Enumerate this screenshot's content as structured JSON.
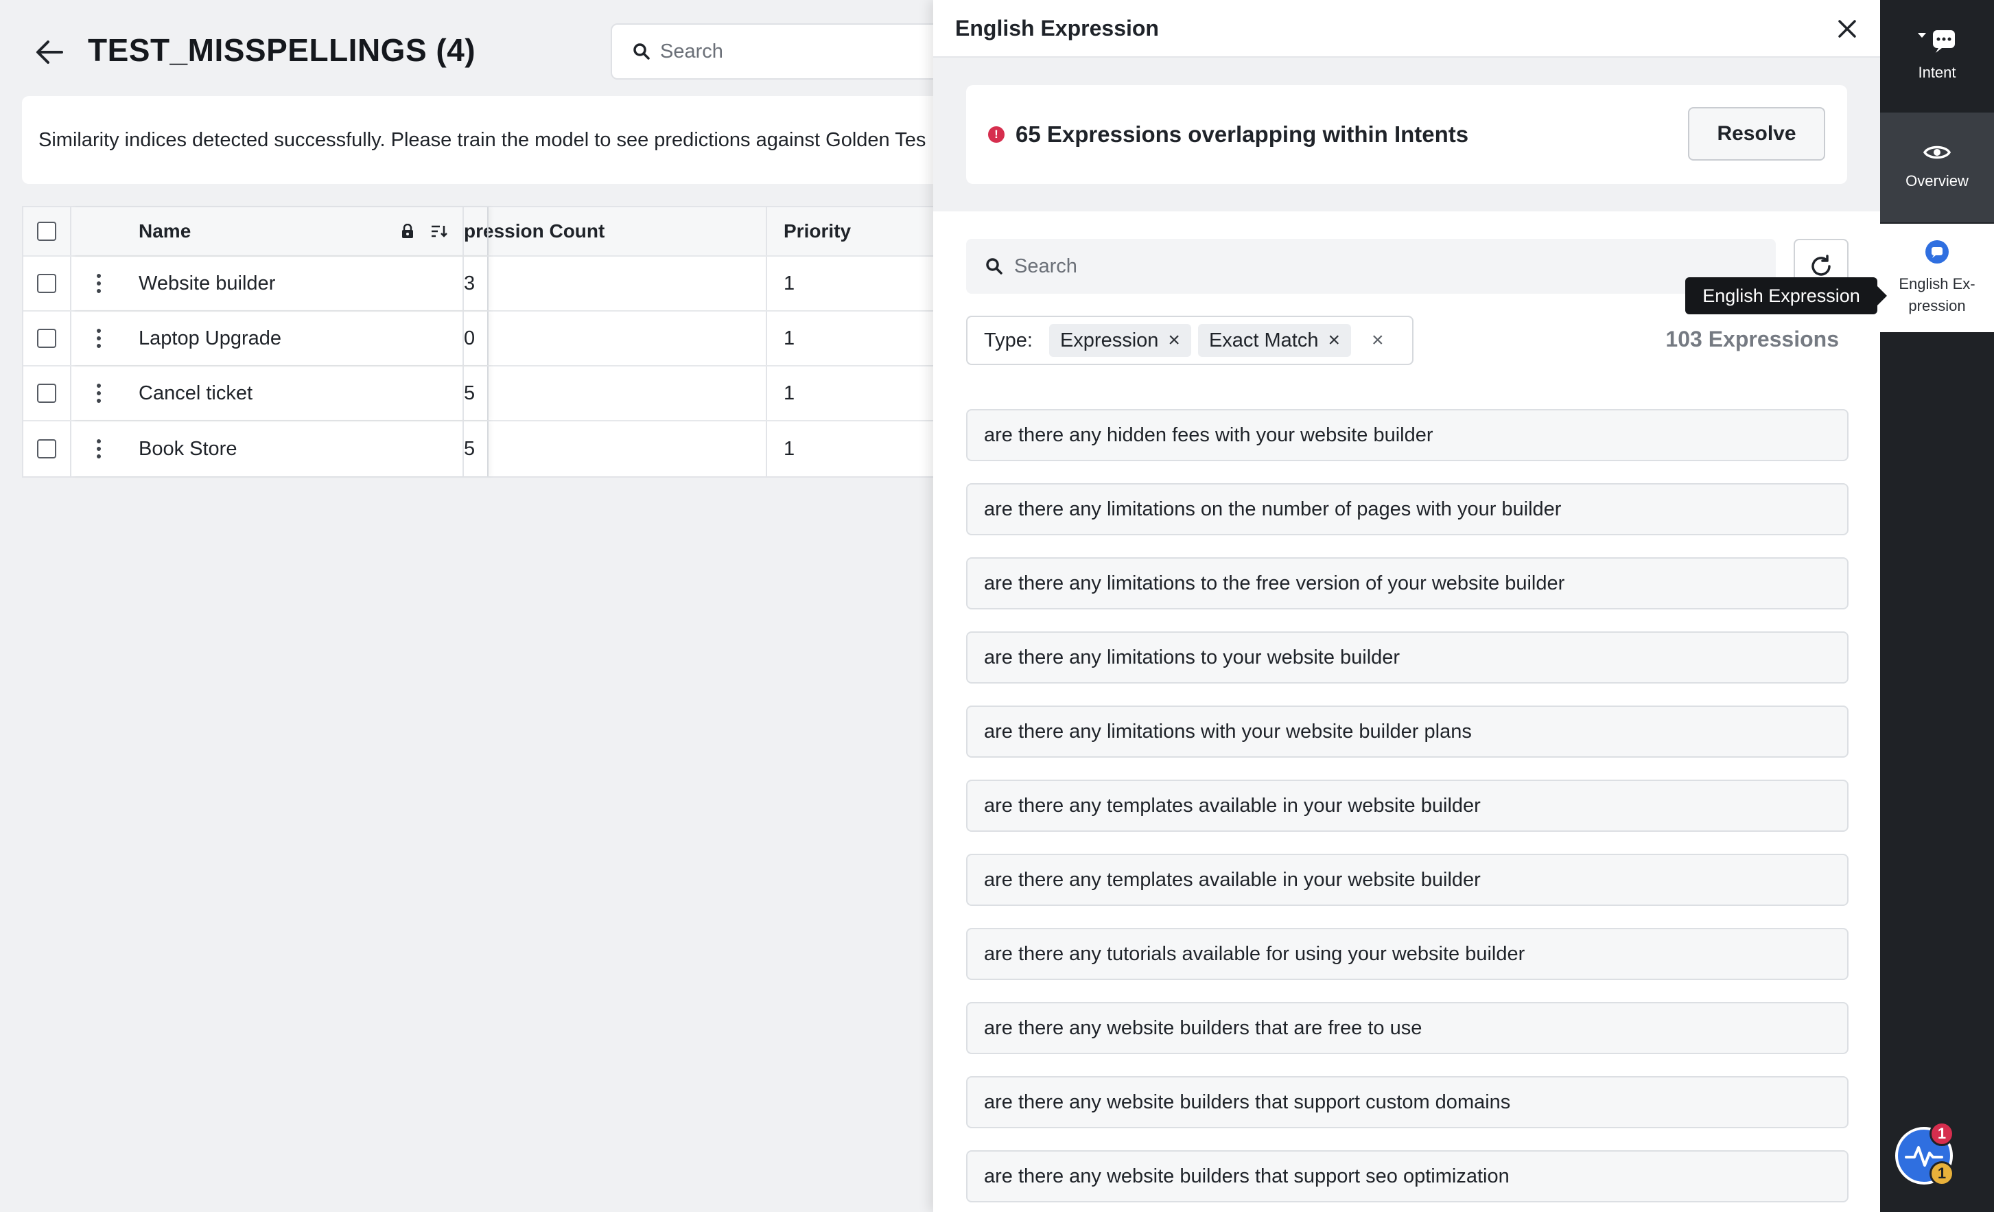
{
  "page": {
    "title": "TEST_MISSPELLINGS (4)",
    "search_placeholder": "Search",
    "banner_text": "Similarity indices detected successfully. Please train the model to see predictions against Golden Tes"
  },
  "table": {
    "columns": {
      "name": "Name",
      "count": "pression Count",
      "priority": "Priority"
    },
    "rows": [
      {
        "name": "Website builder",
        "count": "3",
        "priority": "1"
      },
      {
        "name": "Laptop Upgrade",
        "count": "0",
        "priority": "1"
      },
      {
        "name": "Cancel ticket",
        "count": "5",
        "priority": "1"
      },
      {
        "name": "Book Store",
        "count": "5",
        "priority": "1"
      }
    ]
  },
  "drawer": {
    "title": "English Expression",
    "overlap_text": "65 Expressions overlapping within Intents",
    "resolve_label": "Resolve",
    "search_placeholder": "Search",
    "filter": {
      "label": "Type:",
      "chips": [
        "Expression",
        "Exact Match"
      ],
      "chip_remove": "×",
      "clear": "×"
    },
    "count_text": "103 Expressions",
    "expressions": [
      "are there any hidden fees with your website builder",
      "are there any limitations on the number of pages with your builder",
      "are there any limitations to the free version of your website builder",
      "are there any limitations to your website builder",
      "are there any limitations with your website builder plans",
      "are there any templates available in your website builder",
      "are there any templates available in your website builder",
      "are there any tutorials available for using your website builder",
      "are there any website builders that are free to use",
      "are there any website builders that support custom domains",
      "are there any website builders that support seo optimization"
    ]
  },
  "rail": {
    "intent": "Intent",
    "overview": "Overview",
    "english_line1": "English Ex-",
    "english_line2": "pression",
    "tooltip": "English Expression",
    "badge_red": "1",
    "badge_yellow": "1"
  },
  "colors": {
    "accent": "#2f6fe0",
    "error": "#d62e4e",
    "rail_bg": "#1f2226",
    "warning": "#e8b13b"
  }
}
